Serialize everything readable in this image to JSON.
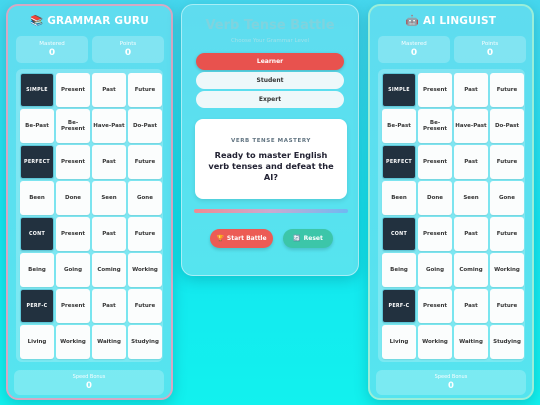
{
  "left_player": {
    "icon": "books-icon",
    "emoji": "📚",
    "name": "GRAMMAR GURU",
    "stats": [
      {
        "label": "Mastered",
        "value": "0"
      },
      {
        "label": "Points",
        "value": "0"
      }
    ],
    "speed": {
      "label": "Speed Bonus",
      "value": "0"
    }
  },
  "right_player": {
    "icon": "robot-icon",
    "emoji": "🤖",
    "name": "AI LINGUIST",
    "stats": [
      {
        "label": "Mastered",
        "value": "0"
      },
      {
        "label": "Points",
        "value": "0"
      }
    ],
    "speed": {
      "label": "Speed Bonus",
      "value": "0"
    }
  },
  "board": [
    [
      "SIMPLE",
      "Present",
      "Past",
      "Future"
    ],
    [
      "Be-Past",
      "Be-Present",
      "Have-Past",
      "Do-Past"
    ],
    [
      "PERFECT",
      "Present",
      "Past",
      "Future"
    ],
    [
      "Been",
      "Done",
      "Seen",
      "Gone"
    ],
    [
      "CONT",
      "Present",
      "Past",
      "Future"
    ],
    [
      "Being",
      "Going",
      "Coming",
      "Working"
    ],
    [
      "PERF-C",
      "Present",
      "Past",
      "Future"
    ],
    [
      "Living",
      "Working",
      "Waiting",
      "Studying"
    ]
  ],
  "center": {
    "title": "Verb Tense Battle",
    "subtitle": "Choose Your Grammar Level",
    "levels": [
      {
        "label": "Learner",
        "active": true
      },
      {
        "label": "Student",
        "active": false
      },
      {
        "label": "Expert",
        "active": false
      }
    ],
    "card": {
      "caption": "VERB TENSE MASTERY",
      "question": "Ready to master English verb tenses and defeat the AI?"
    },
    "start_icon": "🏆",
    "start_label": "Start Battle",
    "reset_icon": "🔄",
    "reset_label": "Reset"
  },
  "colors": {
    "accent_red": "#e8524e",
    "accent_green": "#3cc6a9",
    "header_cell": "#22313f"
  }
}
